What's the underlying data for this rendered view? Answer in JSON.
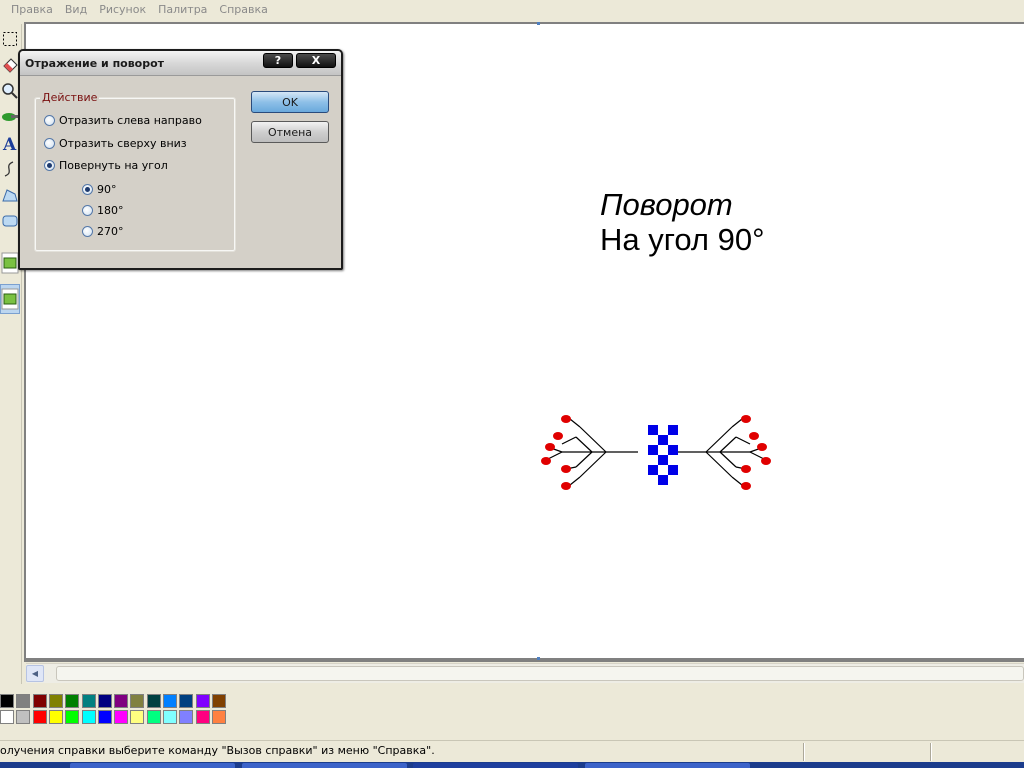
{
  "menu": [
    "Правка",
    "Вид",
    "Рисунок",
    "Палитра",
    "Справка"
  ],
  "tools": [
    "select-rect-icon",
    "eraser-icon",
    "magnifier-icon",
    "airbrush-icon",
    "text-icon",
    "curve-icon",
    "polygon-icon",
    "rounded-rect-icon",
    "transparent-select-icon",
    "opaque-select-icon"
  ],
  "dialog": {
    "title": "Отражение и поворот",
    "help_label": "?",
    "close_label": "X",
    "group_label": "Действие",
    "options": [
      {
        "label": "Отразить слева направо",
        "checked": false
      },
      {
        "label": "Отразить сверху вниз",
        "checked": false
      },
      {
        "label": "Повернуть на угол",
        "checked": true
      }
    ],
    "angles": [
      {
        "label": "90°",
        "checked": true
      },
      {
        "label": "180°",
        "checked": false
      },
      {
        "label": "270°",
        "checked": false
      }
    ],
    "ok_label": "OK",
    "cancel_label": "Отмена"
  },
  "canvas_text": {
    "line1": "Поворот",
    "line2": "На угол 90°"
  },
  "drawing": {
    "ornament_colors": {
      "stem": "#000000",
      "bud": "#e00000",
      "checker": "#0000e8"
    }
  },
  "palette": {
    "row1": [
      "#000000",
      "#808080",
      "#800000",
      "#808000",
      "#008000",
      "#008080",
      "#000080",
      "#800080",
      "#808040",
      "#004040",
      "#0080ff",
      "#004080",
      "#8000ff",
      "#804000"
    ],
    "row2": [
      "#ffffff",
      "#c0c0c0",
      "#ff0000",
      "#ffff00",
      "#00ff00",
      "#00ffff",
      "#0000ff",
      "#ff00ff",
      "#ffff80",
      "#00ff80",
      "#80ffff",
      "#8080ff",
      "#ff0080",
      "#ff8040"
    ]
  },
  "statusbar": {
    "text": "олучения справки выберите команду \"Вызов справки\" из меню \"Справка\"."
  }
}
